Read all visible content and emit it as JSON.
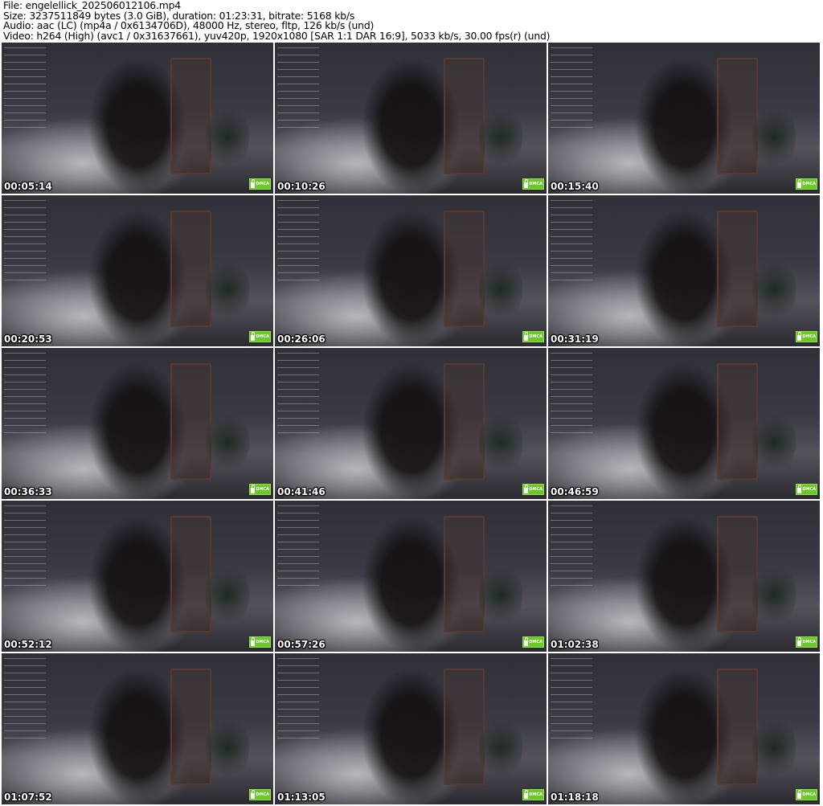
{
  "header": {
    "file": "File: engelellick_202506012106.mp4",
    "size": "Size: 3237511849 bytes (3.0 GiB), duration: 01:23:31, bitrate: 5168 kb/s",
    "audio": "Audio: aac (LC) (mp4a / 0x6134706D), 48000 Hz, stereo, fltp, 126 kb/s (und)",
    "video": "Video: h264 (High) (avc1 / 0x31637661), yuv420p, 1920x1080 [SAR 1:1 DAR 16:9], 5033 kb/s, 30.00 fps(r) (und)"
  },
  "badge_label": "DMCA",
  "badge_color": "#6cc72b",
  "thumbnails": [
    {
      "time": "00:05:14"
    },
    {
      "time": "00:10:26"
    },
    {
      "time": "00:15:40"
    },
    {
      "time": "00:20:53"
    },
    {
      "time": "00:26:06"
    },
    {
      "time": "00:31:19"
    },
    {
      "time": "00:36:33"
    },
    {
      "time": "00:41:46"
    },
    {
      "time": "00:46:59"
    },
    {
      "time": "00:52:12"
    },
    {
      "time": "00:57:26"
    },
    {
      "time": "01:02:38"
    },
    {
      "time": "01:07:52"
    },
    {
      "time": "01:13:05"
    },
    {
      "time": "01:18:18"
    }
  ]
}
